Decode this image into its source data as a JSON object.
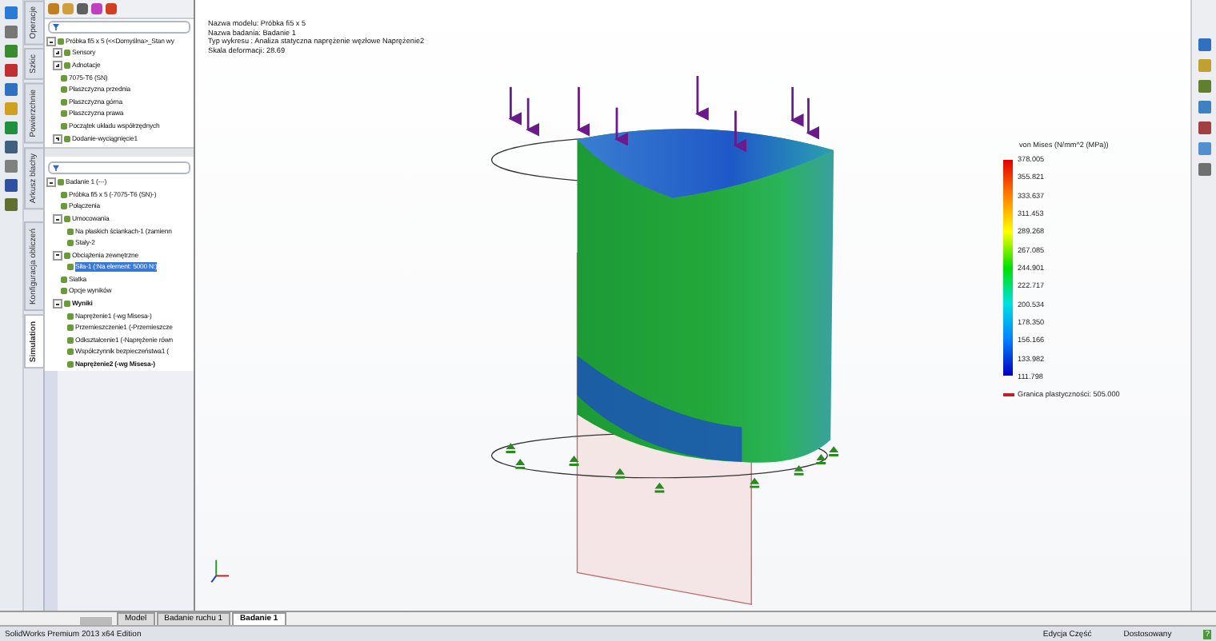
{
  "side_tabs": [
    {
      "label": "Operacje",
      "selected": false
    },
    {
      "label": "Szkic",
      "selected": false
    },
    {
      "label": "Powierzchnie",
      "selected": false
    },
    {
      "label": "Arkusz blachy",
      "selected": false
    },
    {
      "label": "Konfiguracja obliczeń",
      "selected": false
    },
    {
      "label": "Simulation",
      "selected": true
    }
  ],
  "feature_tree": [
    {
      "label": "Próbka fi5 x 5  (<<Domyślna>_Stan wy",
      "expanded": true,
      "selected": false,
      "children": [
        {
          "label": "Sensory",
          "expanded": false,
          "selected": false
        },
        {
          "label": "Adnotacje",
          "expanded": false,
          "selected": false
        },
        {
          "label": "7075-T6 (SN)",
          "selected": false
        },
        {
          "label": "Płaszczyzna przednia",
          "selected": false
        },
        {
          "label": "Płaszczyzna górna",
          "selected": false
        },
        {
          "label": "Płaszczyzna prawa",
          "selected": false
        },
        {
          "label": "Początek układu współrzędnych",
          "selected": false
        },
        {
          "label": "Dodanie-wyciągnięcie1",
          "expanded": false,
          "selected": false
        }
      ]
    }
  ],
  "study_tree": [
    {
      "label": "Badanie 1 (-·-)",
      "expanded": true,
      "selected": false,
      "children": [
        {
          "label": "Próbka fi5 x 5 (-7075-T6 (SN)-)",
          "selected": false
        },
        {
          "label": "Połączenia",
          "selected": false
        },
        {
          "label": "Umocowania",
          "expanded": true,
          "selected": false,
          "children": [
            {
              "label": "Na płaskich ściankach-1 (zamienn",
              "selected": false
            },
            {
              "label": "Stały-2",
              "selected": false
            }
          ]
        },
        {
          "label": "Obciążenia zewnętrzne",
          "expanded": true,
          "selected": false,
          "children": [
            {
              "label": "Siła-1 (:Na element: 5000 N:)",
              "selected": true
            }
          ]
        },
        {
          "label": "Siatka",
          "selected": false
        },
        {
          "label": "Opcje wyników",
          "selected": false
        },
        {
          "label": "Wyniki",
          "expanded": true,
          "selected": false,
          "bold": true,
          "children": [
            {
              "label": "Naprężenie1 (-wg Misesa-)",
              "selected": false
            },
            {
              "label": "Przemieszczenie1 (-Przemieszcze",
              "selected": false
            },
            {
              "label": "Odkształcenie1 (-Naprężenie równ",
              "selected": false
            },
            {
              "label": "Współczynnik bezpieczeństwa1 (",
              "selected": false
            },
            {
              "label": "Naprężenie2 (-wg Misesa-)",
              "selected": false,
              "bold": true
            }
          ]
        }
      ]
    }
  ],
  "viewport": {
    "info": [
      "Nazwa modelu: Próbka fi5 x 5",
      "Nazwa badania: Badanie 1",
      "Typ wykresu : Analiza statyczna naprężenie węzłowe Naprężenie2",
      "Skala deformacji: 28.69"
    ],
    "legend": {
      "title": "von Mises (N/mm^2 (MPa))",
      "values": [
        "378.005",
        "355.821",
        "333.637",
        "311.453",
        "289.268",
        "267.085",
        "244.901",
        "222.717",
        "200.534",
        "178.350",
        "156.166",
        "133.982",
        "111.798"
      ],
      "yield_label": "Granica plastyczności: 505.000"
    }
  },
  "bottom_tabs": [
    {
      "label": "Model",
      "selected": false
    },
    {
      "label": "Badanie ruchu 1",
      "selected": false
    },
    {
      "label": "Badanie 1",
      "selected": true
    }
  ],
  "status_bar": {
    "product": "SolidWorks Premium 2013 x64 Edition",
    "mode": "Edycja Część",
    "units": "Dostosowany",
    "help": "?"
  }
}
